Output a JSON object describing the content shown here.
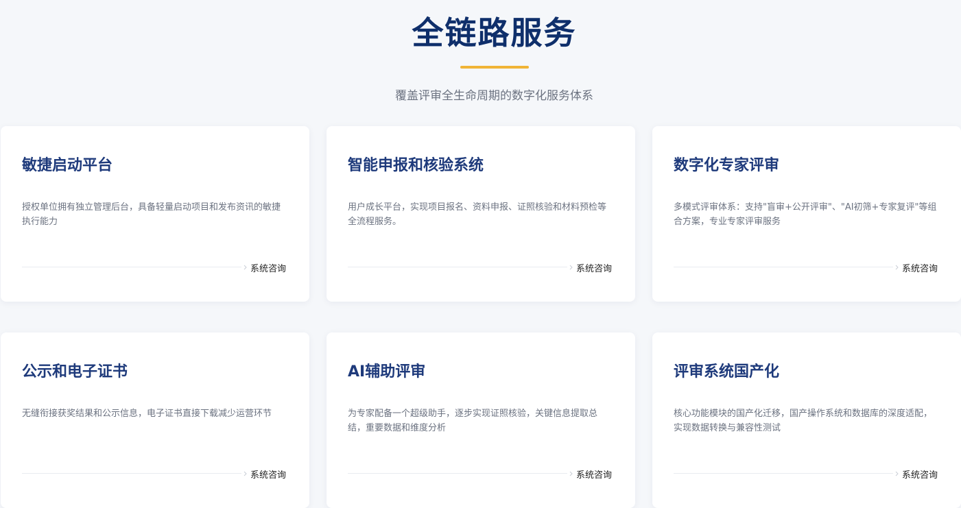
{
  "header": {
    "title": "全链路服务",
    "subtitle": "覆盖评审全生命周期的数字化服务体系"
  },
  "colors": {
    "title": "#0f2f6b",
    "card_title": "#1e3a7b",
    "accent": "#f0b437",
    "background": "#f5f7fa"
  },
  "cards": [
    {
      "title": "敏捷启动平台",
      "description": "授权单位拥有独立管理后台，具备轻量启动项目和发布资讯的敏捷执行能力",
      "link_label": "系统咨询",
      "link_icon": "chevron-right-icon"
    },
    {
      "title": "智能申报和核验系统",
      "description": "用户成长平台，实现项目报名、资料申报、证照核验和材料预检等全流程服务。",
      "link_label": "系统咨询",
      "link_icon": "chevron-right-icon"
    },
    {
      "title": "数字化专家评审",
      "description": "多模式评审体系：支持\"盲审+公开评审\"、\"AI初筛+专家复评\"等组合方案，专业专家评审服务",
      "link_label": "系统咨询",
      "link_icon": "chevron-right-icon"
    },
    {
      "title": "公示和电子证书",
      "description": "无缝衔接获奖结果和公示信息，电子证书直接下载减少运营环节",
      "link_label": "系统咨询",
      "link_icon": "chevron-right-icon"
    },
    {
      "title": "AI辅助评审",
      "description": "为专家配备一个超级助手，逐步实现证照核验，关键信息提取总结，重要数据和维度分析",
      "link_label": "系统咨询",
      "link_icon": "chevron-right-icon"
    },
    {
      "title": "评审系统国产化",
      "description": "核心功能模块的国产化迁移，国产操作系统和数据库的深度适配，实现数据转换与兼容性测试",
      "link_label": "系统咨询",
      "link_icon": "chevron-right-icon"
    }
  ]
}
